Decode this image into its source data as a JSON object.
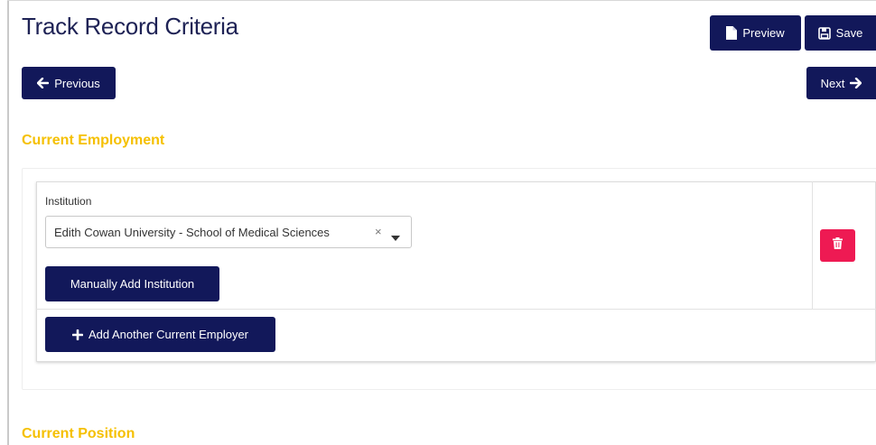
{
  "header": {
    "title": "Track Record Criteria",
    "preview_label": "Preview",
    "save_label": "Save"
  },
  "nav": {
    "previous_label": "Previous",
    "next_label": "Next"
  },
  "sections": {
    "employment_heading": "Current Employment",
    "position_heading": "Current Position"
  },
  "employer": {
    "institution_label": "Institution",
    "institution_value": "Edith Cowan University - School of Medical Sciences",
    "clear_glyph": "×",
    "manual_add_label": "Manually Add Institution",
    "add_another_label": "Add Another Current Employer"
  },
  "colors": {
    "primary": "#12185a",
    "accent": "#f5c000",
    "danger": "#ee1a53",
    "title": "#1e2255"
  },
  "icons": {
    "preview": "file-icon",
    "save": "floppy-disk-icon",
    "previous": "arrow-left-icon",
    "next": "arrow-right-icon",
    "add": "plus-icon",
    "delete": "trash-icon",
    "caret": "caret-down-icon"
  }
}
